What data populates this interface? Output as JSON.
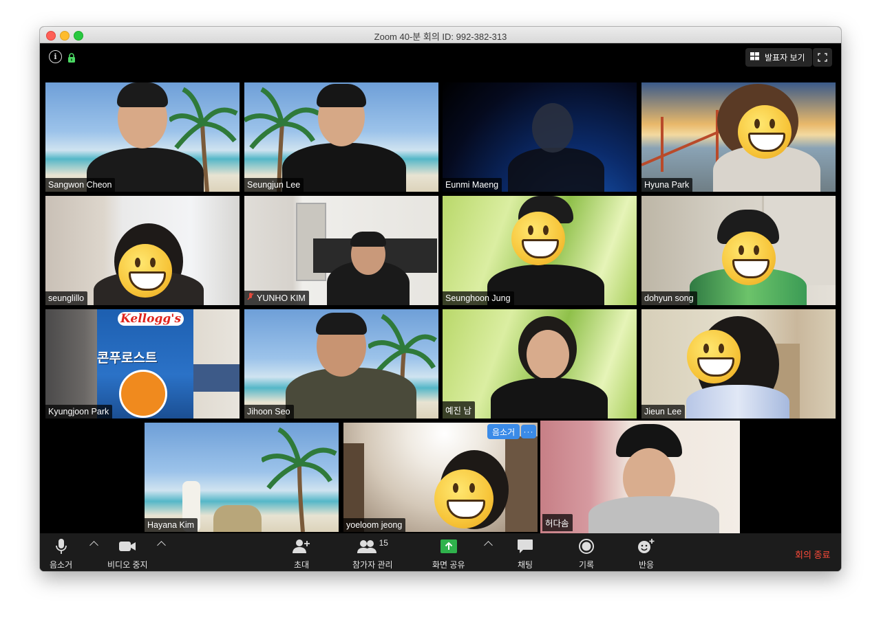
{
  "window": {
    "title": "Zoom   40-분  회의 ID: 992-382-313"
  },
  "topbar": {
    "speaker_view_label": "발표자 보기"
  },
  "participants": [
    {
      "name": "Sangwon Cheon"
    },
    {
      "name": "Seungjun Lee"
    },
    {
      "name": "Eunmi Maeng"
    },
    {
      "name": "Hyuna Park"
    },
    {
      "name": "seunglillo"
    },
    {
      "name": "YUNHO KIM"
    },
    {
      "name": "Seunghoon Jung"
    },
    {
      "name": "dohyun song"
    },
    {
      "name": "Kyungjoon Park"
    },
    {
      "name": "Jihoon Seo"
    },
    {
      "name": "예진 남"
    },
    {
      "name": "Jieun Lee"
    },
    {
      "name": "Hayana Kim"
    },
    {
      "name": "yoeloom jeong"
    },
    {
      "name": "허다솜"
    }
  ],
  "tile_popup": {
    "mute_label": "음소거",
    "more_label": "···"
  },
  "cereal_box": {
    "brand": "Kellogg's",
    "product": "콘푸로스트"
  },
  "toolbar": {
    "mute_label": "음소거",
    "stop_video_label": "비디오 중지",
    "invite_label": "초대",
    "participants_label": "참가자 관리",
    "participants_count": "15",
    "share_label": "화면 공유",
    "chat_label": "채팅",
    "record_label": "기록",
    "reactions_label": "반응",
    "end_label": "회의 종료"
  },
  "colors": {
    "active_speaker": "#e8ee3f",
    "share_green": "#2fb24c",
    "end_red": "#ff4b3a",
    "badge_blue": "#3b8be8"
  }
}
